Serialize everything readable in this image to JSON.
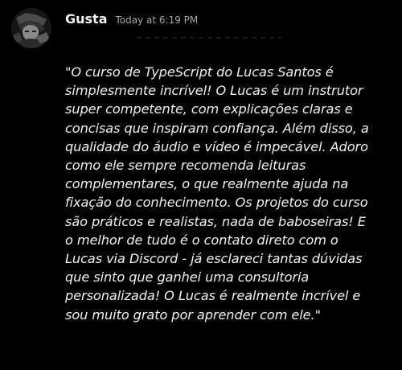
{
  "message": {
    "author": "Gusta",
    "timestamp": "Today at 6:19 PM",
    "avatar_icon": "user-avatar",
    "lines": [
      "\"O curso de TypeScript do Lucas Santos é",
      "simplesmente incrível! O Lucas é um instrutor",
      "super competente, com explicações claras e",
      "concisas que inspiram confiança. Além disso, a",
      "qualidade do áudio e vídeo é impecável. Adoro",
      "como ele sempre recomenda leituras",
      "complementares, o que realmente ajuda na",
      "fixação do conhecimento. Os projetos do curso",
      "são práticos e realistas, nada de baboseiras! E",
      "o melhor de tudo é o contato direto com o",
      "Lucas via Discord - já esclareci tantas dúvidas",
      "que sinto que ganhei uma consultoria",
      "personalizada! O Lucas é realmente incrível e",
      "sou muito grato por aprender com ele.\""
    ]
  },
  "colors": {
    "background": "#000000",
    "username": "#f2f3f5",
    "timestamp": "#a3a6aa",
    "text": "#f0f0f0"
  }
}
